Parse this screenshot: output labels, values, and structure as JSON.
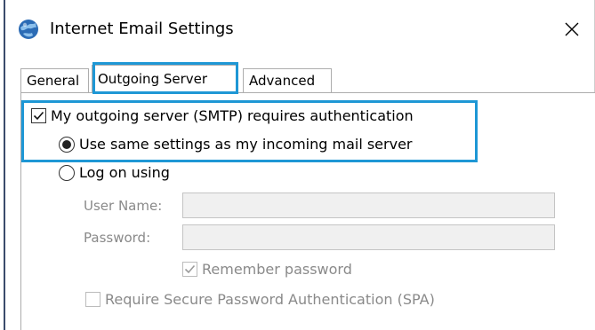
{
  "window": {
    "title": "Internet Email Settings",
    "icon": "globe-mail-icon",
    "close_icon": "close-icon"
  },
  "tabs": [
    {
      "label": "General",
      "selected": false
    },
    {
      "label": "Outgoing Server",
      "selected": true
    },
    {
      "label": "Advanced",
      "selected": false
    }
  ],
  "outgoing": {
    "auth_checkbox": {
      "label": "My outgoing server (SMTP) requires authentication",
      "checked": true
    },
    "same_settings_radio": {
      "label": "Use same settings as my incoming mail server",
      "selected": true
    },
    "logon_radio": {
      "label": "Log on using",
      "selected": false
    },
    "user_name": {
      "label": "User Name:",
      "value": ""
    },
    "password": {
      "label": "Password:",
      "value": ""
    },
    "remember_password": {
      "label": "Remember password",
      "checked": true,
      "enabled": false
    },
    "spa": {
      "label": "Require Secure Password Authentication (SPA)",
      "checked": false,
      "enabled": false
    }
  },
  "colors": {
    "highlight": "#1e97d5",
    "frame": "#3a4b6b"
  }
}
